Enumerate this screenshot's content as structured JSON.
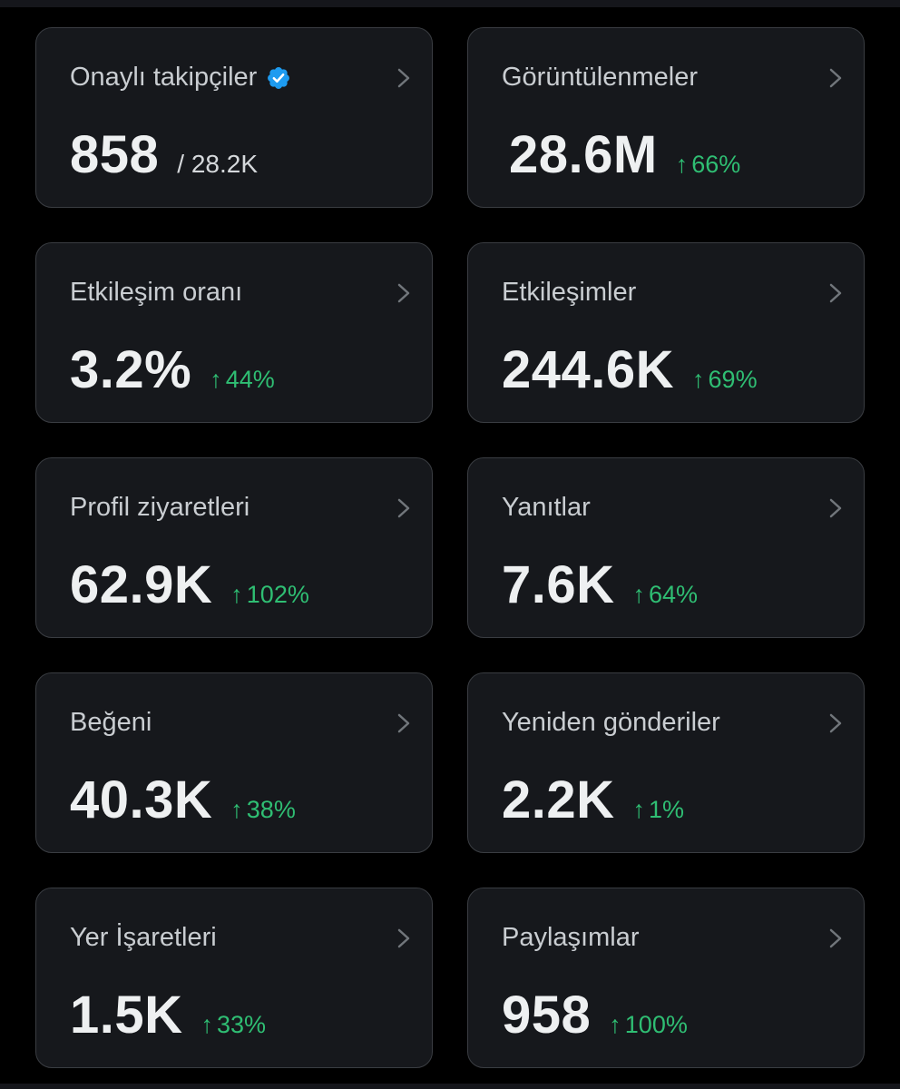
{
  "colors": {
    "background": "#000000",
    "card": "#16181c",
    "card_border": "#3a3d42",
    "positive": "#2fbe73",
    "verified": "#1d9bf0"
  },
  "metrics": [
    {
      "title": "Onaylı takipçiler",
      "value": "858",
      "secondary": "/ 28.2K",
      "verified_icon": "verified-badge-icon"
    },
    {
      "title": "Görüntülenmeler",
      "value": "28.6M",
      "arrow": "↑",
      "change": "66%"
    },
    {
      "title": "Etkileşim oranı",
      "value": "3.2%",
      "arrow": "↑",
      "change": "44%"
    },
    {
      "title": "Etkileşimler",
      "value": "244.6K",
      "arrow": "↑",
      "change": "69%"
    },
    {
      "title": "Profil ziyaretleri",
      "value": "62.9K",
      "arrow": "↑",
      "change": "102%"
    },
    {
      "title": "Yanıtlar",
      "value": "7.6K",
      "arrow": "↑",
      "change": "64%"
    },
    {
      "title": "Beğeni",
      "value": "40.3K",
      "arrow": "↑",
      "change": "38%"
    },
    {
      "title": "Yeniden gönderiler",
      "value": "2.2K",
      "arrow": "↑",
      "change": "1%"
    },
    {
      "title": "Yer İşaretleri",
      "value": "1.5K",
      "arrow": "↑",
      "change": "33%"
    },
    {
      "title": "Paylaşımlar",
      "value": "958",
      "arrow": "↑",
      "change": "100%"
    }
  ],
  "icons": {
    "chevron": "chevron-right-icon",
    "up_arrow": "up-arrow-icon"
  }
}
